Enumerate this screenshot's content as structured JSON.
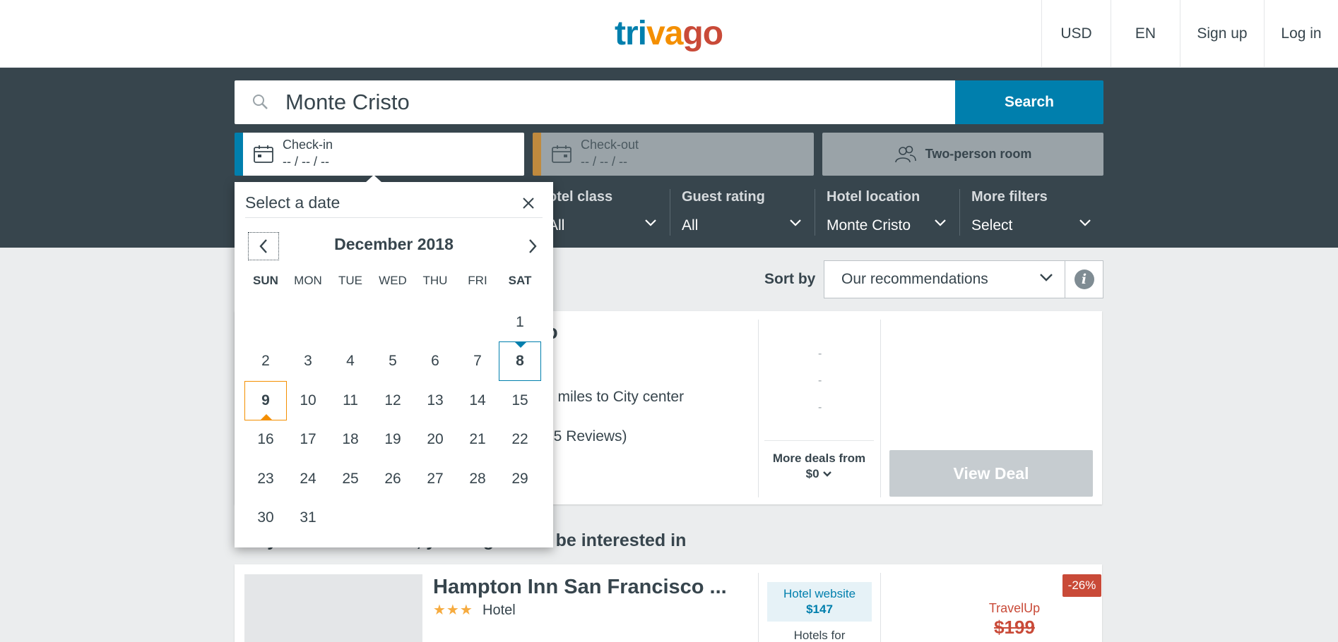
{
  "header": {
    "logo": {
      "part1": "tri",
      "part2": "va",
      "part3": "go"
    },
    "currency": "USD",
    "language": "EN",
    "signup": "Sign up",
    "login": "Log in"
  },
  "search": {
    "query": "Monte Cristo",
    "button": "Search",
    "checkin_label": "Check-in",
    "checkin_value": "-- / -- / --",
    "checkout_label": "Check-out",
    "checkout_value": "-- / -- / --",
    "room": "Two-person room"
  },
  "filters": {
    "hotel_class": {
      "label": "otel class",
      "value": "All"
    },
    "guest_rating": {
      "label": "Guest rating",
      "value": "All"
    },
    "hotel_location": {
      "label": "Hotel location",
      "value": "Monte Cristo"
    },
    "more_filters": {
      "label": "More filters",
      "value": "Select"
    }
  },
  "sort": {
    "label": "Sort by",
    "value": "Our recommendations",
    "info_icon": "i"
  },
  "card1": {
    "name_fragment": "o",
    "distance_fragment": "1 miles to City center",
    "reviews_fragment": "75 Reviews)",
    "dash": "-",
    "more_deals_line1": "More deals from",
    "more_deals_line2": "$0",
    "view_deal": "View Deal"
  },
  "interest_heading": "If you like this hotel, you might also be interested in",
  "card2": {
    "name": "Hampton Inn San Francisco ...",
    "stars": "★★★",
    "type": "Hotel",
    "hotel_website_label": "Hotel website",
    "hotel_website_price": "$147",
    "hotels_for": "Hotels for",
    "discount": "-26%",
    "provider": "TravelUp",
    "old_price": "$199"
  },
  "datepicker": {
    "title": "Select a date",
    "month": "December 2018",
    "weekdays": [
      "SUN",
      "MON",
      "TUE",
      "WED",
      "THU",
      "FRI",
      "SAT"
    ],
    "checkin_day": "9",
    "today_day": "8"
  },
  "colors": {
    "brand_blue": "#007fad",
    "brand_orange": "#f48f00",
    "brand_red": "#c94a38",
    "dark_band": "#37454d"
  }
}
